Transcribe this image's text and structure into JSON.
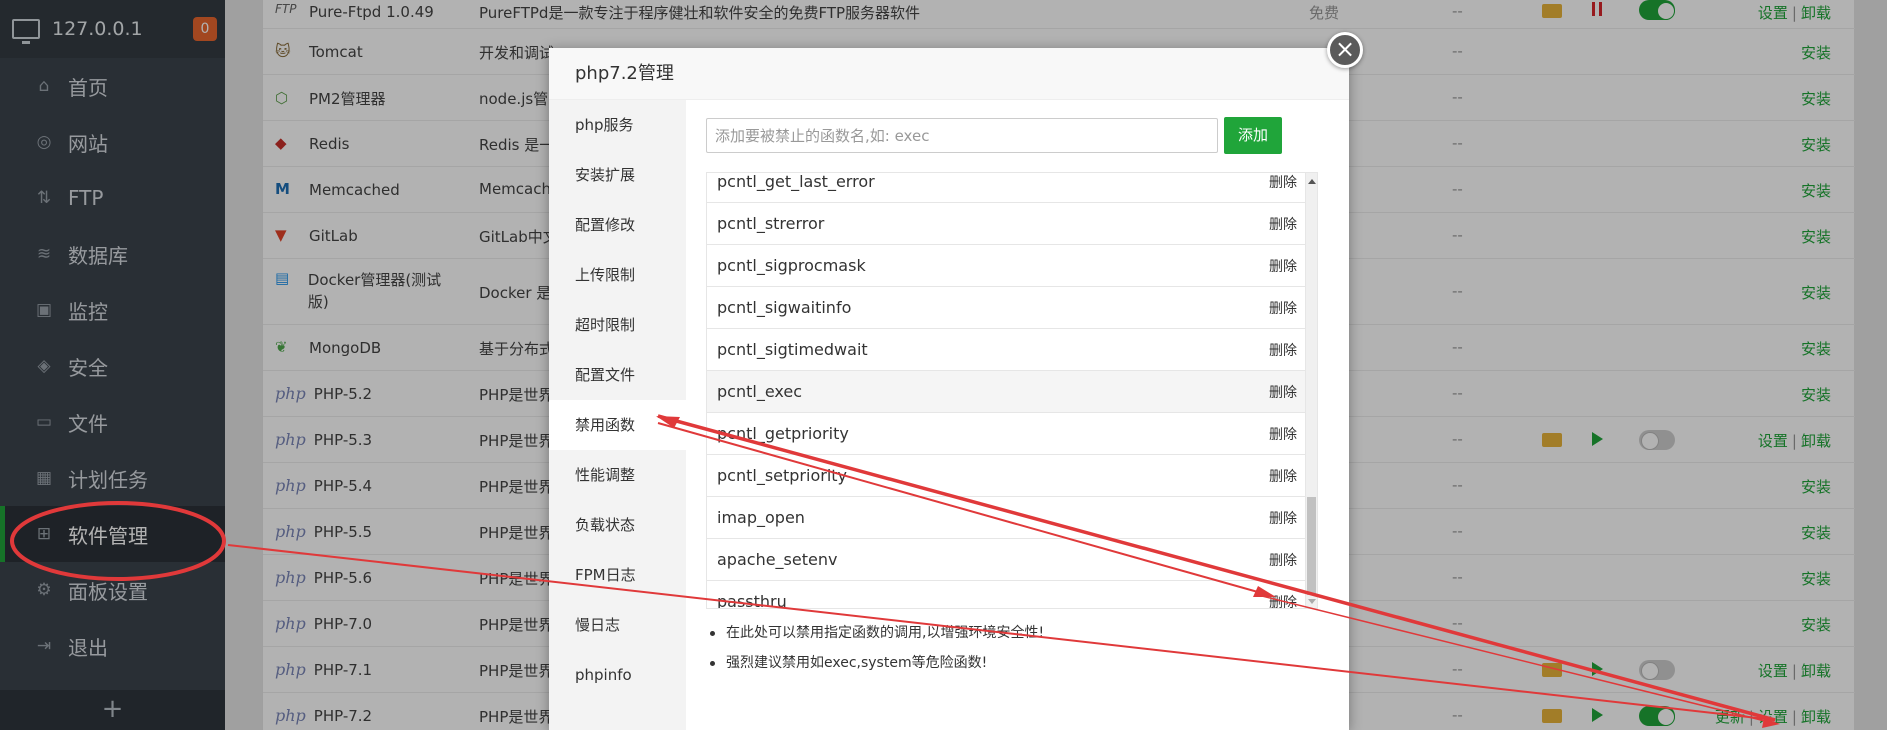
{
  "sidebar": {
    "ip": "127.0.0.1",
    "badge": "0",
    "items": [
      {
        "label": "首页",
        "icon": "home-icon"
      },
      {
        "label": "网站",
        "icon": "globe-icon"
      },
      {
        "label": "FTP",
        "icon": "ftp-icon"
      },
      {
        "label": "数据库",
        "icon": "database-icon"
      },
      {
        "label": "监控",
        "icon": "monitor-icon"
      },
      {
        "label": "安全",
        "icon": "shield-icon"
      },
      {
        "label": "文件",
        "icon": "folder-icon"
      },
      {
        "label": "计划任务",
        "icon": "calendar-icon"
      },
      {
        "label": "软件管理",
        "icon": "grid-icon"
      },
      {
        "label": "面板设置",
        "icon": "gear-icon"
      },
      {
        "label": "退出",
        "icon": "logout-icon"
      }
    ],
    "add_label": "+"
  },
  "software": {
    "rows": [
      {
        "name": "Pure-Ftpd 1.0.49",
        "desc": "PureFTPd是一款专注于程序健壮和软件安全的免费FTP服务器软件",
        "price": "免费",
        "expire": "--",
        "ops": [
          "设置",
          "卸载"
        ]
      },
      {
        "name": "Tomcat",
        "desc": "开发和调试",
        "price": "",
        "expire": "--",
        "ops": [
          "安装"
        ]
      },
      {
        "name": "PM2管理器",
        "desc": "node.js管",
        "price": "",
        "expire": "--",
        "ops": [
          "安装"
        ]
      },
      {
        "name": "Redis",
        "desc": "Redis 是一",
        "price": "",
        "expire": "--",
        "ops": [
          "安装"
        ]
      },
      {
        "name": "Memcached",
        "desc": "Memcach",
        "price": "",
        "expire": "--",
        "ops": [
          "安装"
        ]
      },
      {
        "name": "GitLab",
        "desc": "GitLab中文",
        "price": "",
        "expire": "--",
        "ops": [
          "安装"
        ]
      },
      {
        "name": "Docker管理器(测试版)",
        "desc": "Docker 是",
        "price": "",
        "expire": "--",
        "ops": [
          "安装"
        ]
      },
      {
        "name": "MongoDB",
        "desc": "基于分布式",
        "price": "",
        "expire": "--",
        "ops": [
          "安装"
        ]
      },
      {
        "name": "PHP-5.2",
        "desc": "PHP是世界",
        "price": "",
        "expire": "--",
        "ops": [
          "安装"
        ]
      },
      {
        "name": "PHP-5.3",
        "desc": "PHP是世界",
        "price": "",
        "expire": "--",
        "ops": [
          "设置",
          "卸载"
        ]
      },
      {
        "name": "PHP-5.4",
        "desc": "PHP是世界",
        "price": "",
        "expire": "--",
        "ops": [
          "安装"
        ]
      },
      {
        "name": "PHP-5.5",
        "desc": "PHP是世界",
        "price": "",
        "expire": "--",
        "ops": [
          "安装"
        ]
      },
      {
        "name": "PHP-5.6",
        "desc": "PHP是世界",
        "price": "",
        "expire": "--",
        "ops": [
          "安装"
        ]
      },
      {
        "name": "PHP-7.0",
        "desc": "PHP是世界",
        "price": "",
        "expire": "--",
        "ops": [
          "安装"
        ]
      },
      {
        "name": "PHP-7.1",
        "desc": "PHP是世界",
        "price": "",
        "expire": "--",
        "ops": [
          "设置",
          "卸载"
        ]
      },
      {
        "name": "PHP-7.2",
        "desc": "PHP是世界",
        "price": "",
        "expire": "--",
        "ops": [
          "更新",
          "设置",
          "卸载"
        ]
      }
    ]
  },
  "modal": {
    "title": "php7.2管理",
    "close": "×",
    "menu": [
      "php服务",
      "安装扩展",
      "配置修改",
      "上传限制",
      "超时限制",
      "配置文件",
      "禁用函数",
      "性能调整",
      "负载状态",
      "FPM日志",
      "慢日志",
      "phpinfo"
    ],
    "input_placeholder": "添加要被禁止的函数名,如: exec",
    "add_label": "添加",
    "functions": [
      {
        "name": "pcntl_get_last_error",
        "action": "删除"
      },
      {
        "name": "pcntl_strerror",
        "action": "删除"
      },
      {
        "name": "pcntl_sigprocmask",
        "action": "删除"
      },
      {
        "name": "pcntl_sigwaitinfo",
        "action": "删除"
      },
      {
        "name": "pcntl_sigtimedwait",
        "action": "删除"
      },
      {
        "name": "pcntl_exec",
        "action": "删除"
      },
      {
        "name": "pcntl_getpriority",
        "action": "删除"
      },
      {
        "name": "pcntl_setpriority",
        "action": "删除"
      },
      {
        "name": "imap_open",
        "action": "删除"
      },
      {
        "name": "apache_setenv",
        "action": "删除"
      },
      {
        "name": "passthru",
        "action": "删除"
      }
    ],
    "tips": [
      "在此处可以禁用指定函数的调用,以增强环境安全性!",
      "强烈建议禁用如exec,system等危险函数!"
    ]
  },
  "colors": {
    "accent": "#20a53a",
    "annotation": "#e0393a",
    "sidebar_bg": "#3c444d"
  }
}
